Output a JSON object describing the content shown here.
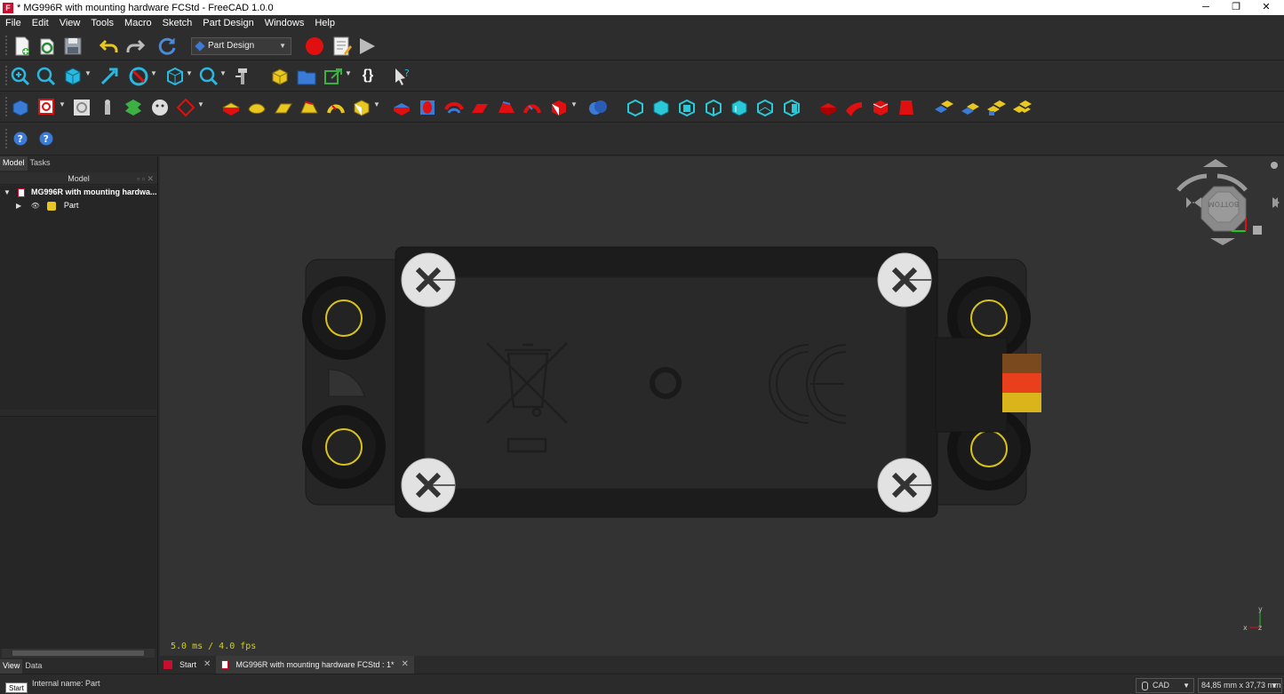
{
  "window": {
    "title": "* MG996R with mounting hardware FCStd - FreeCAD 1.0.0",
    "minimize": "─",
    "restore": "❐",
    "close": "✕"
  },
  "menu": [
    "File",
    "Edit",
    "View",
    "Tools",
    "Macro",
    "Sketch",
    "Part Design",
    "Windows",
    "Help"
  ],
  "workbench": {
    "selected": "Part Design"
  },
  "left_panel": {
    "tabs": [
      "Model",
      "Tasks"
    ],
    "header": "Model",
    "header_buttons": "▫ ▫ ✕",
    "tree": [
      {
        "label": "MG996R with mounting hardwa...",
        "expander": "▼"
      },
      {
        "label": "Part",
        "expander": "▶",
        "visibility": "👁"
      }
    ],
    "bottom_tabs": [
      "View",
      "Data"
    ]
  },
  "viewport": {
    "fps": "5.0 ms / 4.0 fps",
    "navcube_label": "BOTTOM",
    "axis_labels": {
      "x": "x",
      "y": "y",
      "z": "z"
    }
  },
  "doc_tabs": [
    {
      "label": "Start",
      "close": "✕"
    },
    {
      "label": "MG996R with mounting hardware FCStd : 1*",
      "close": "✕"
    }
  ],
  "status": {
    "tooltip": "Start",
    "text": "Internal name: Part",
    "nav_style": "CAD",
    "dimensions": "84,85 mm x 37,73 mm"
  },
  "colors": {
    "wire_brown": "#7a4a1e",
    "wire_red": "#e8401c",
    "wire_yellow": "#d9b41a",
    "ring_yellow": "#d9c21a"
  }
}
